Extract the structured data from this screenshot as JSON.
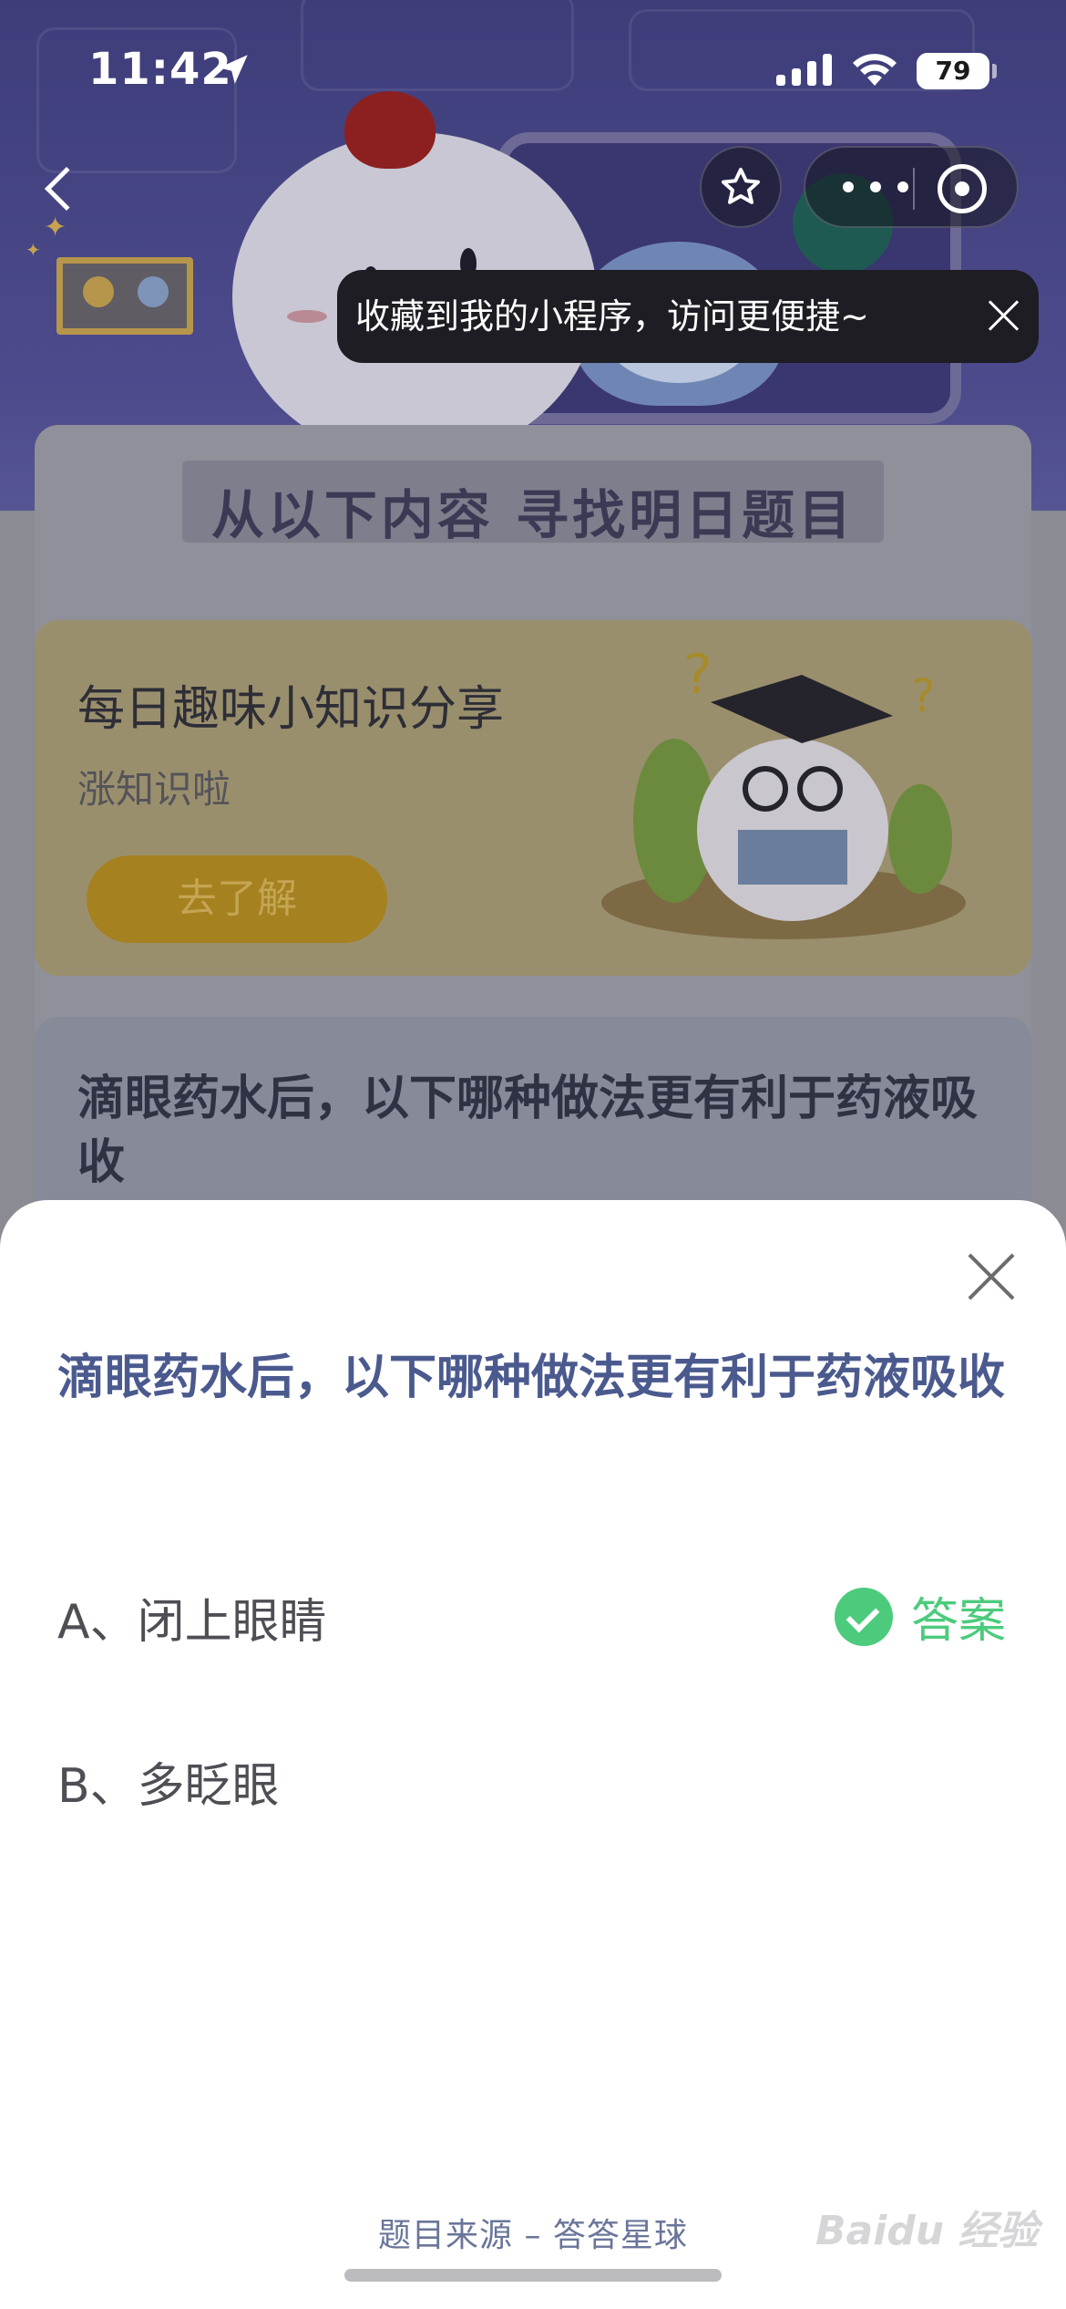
{
  "status_bar": {
    "time": "11:42",
    "battery": "79"
  },
  "nav": {
    "back_icon": "chevron-left-icon",
    "favorite_icon": "star-icon",
    "more_icon": "more-dots-icon",
    "close_icon": "target-close-icon"
  },
  "tooltip": {
    "text": "收藏到我的小程序，访问更便捷~"
  },
  "background_page": {
    "heading": "从以下内容 寻找明日题目",
    "fun_card": {
      "title": "每日趣味小知识分享",
      "subtitle": "涨知识啦",
      "button": "去了解"
    },
    "question_card": {
      "text": "滴眼药水后，以下哪种做法更有利于药液吸收"
    }
  },
  "sheet": {
    "question": "滴眼药水后，以下哪种做法更有利于药液吸收",
    "options": [
      {
        "label": "A、闭上眼睛",
        "is_answer": true
      },
      {
        "label": "B、多眨眼",
        "is_answer": false
      }
    ],
    "answer_label": "答案",
    "source": "题目来源 – 答答星球"
  },
  "watermark": "Baidu 经验",
  "colors": {
    "accent_question": "#4b5a8e",
    "answer_green": "#4ccb7c",
    "header_bg": "#3e3d7a"
  }
}
